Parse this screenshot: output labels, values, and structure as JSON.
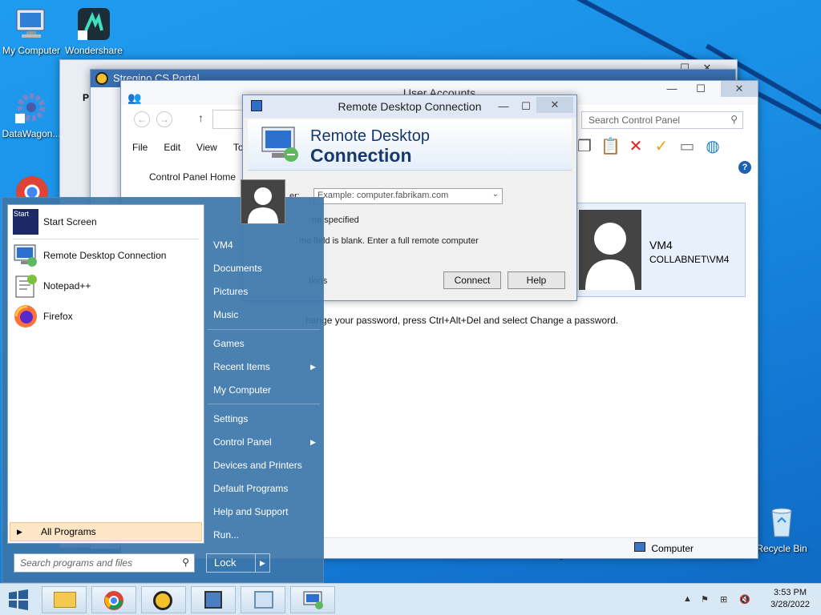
{
  "desktop": {
    "icons": [
      {
        "label": "My Computer"
      },
      {
        "label": "Wondershare"
      },
      {
        "label": "DataWagon..."
      },
      {
        "label": "Recycle Bin"
      }
    ]
  },
  "back_window": {
    "title": "Stregino CS Portal"
  },
  "user_accounts": {
    "title": "User Accounts",
    "search_placeholder": "Search Control Panel",
    "menu": [
      "File",
      "Edit",
      "View",
      "Tool"
    ],
    "nav_home": "Control Panel Home",
    "user_name": "VM4",
    "user_domain": "COLLABNET\\VM4",
    "hint": "hange your password, press Ctrl+Alt+Del and select Change a password.",
    "status_item": "Computer"
  },
  "rdc": {
    "title": "Remote Desktop Connection",
    "banner_line1": "Remote Desktop",
    "banner_line2": "Connection",
    "computer_label": "er:",
    "computer_placeholder": "Example: computer.fabrikam.com",
    "none_specified": "ne specified",
    "blank_msg": "me field is blank. Enter a full remote computer",
    "options": "tions",
    "connect_label": "Connect",
    "help_label": "Help"
  },
  "start_menu": {
    "left_items": [
      {
        "label": "Start Screen"
      },
      {
        "label": "Remote Desktop Connection"
      },
      {
        "label": "Notepad++"
      },
      {
        "label": "Firefox"
      }
    ],
    "all_programs": "All Programs",
    "search_placeholder": "Search programs and files",
    "right_items": [
      {
        "label": "VM4"
      },
      {
        "label": "Documents"
      },
      {
        "label": "Pictures"
      },
      {
        "label": "Music"
      },
      {
        "label": "Games"
      },
      {
        "label": "Recent Items"
      },
      {
        "label": "My Computer"
      },
      {
        "label": "Settings"
      },
      {
        "label": "Control Panel"
      },
      {
        "label": "Devices and Printers"
      },
      {
        "label": "Default Programs"
      },
      {
        "label": "Help and Support"
      },
      {
        "label": "Run..."
      }
    ],
    "lock_label": "Lock"
  },
  "taskbar": {
    "time": "3:53 PM",
    "date": "3/28/2022"
  }
}
